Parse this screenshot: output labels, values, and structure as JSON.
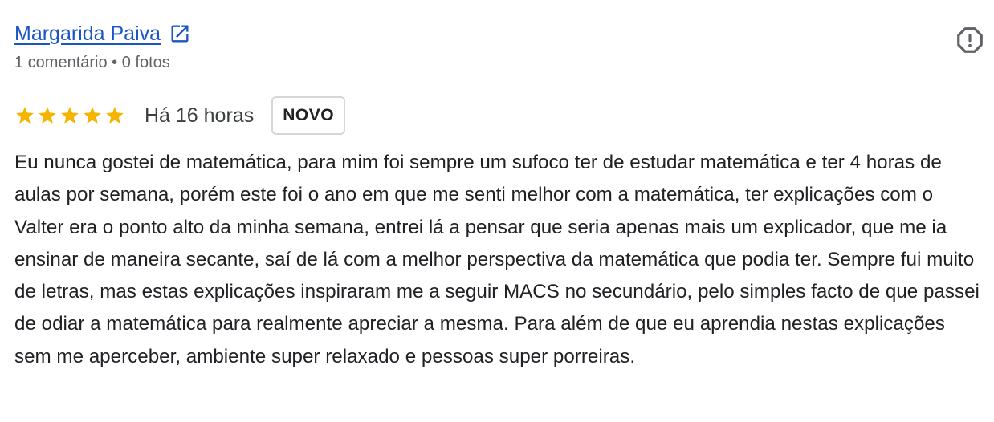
{
  "review": {
    "author_name": "Margarida Paiva",
    "author_meta": "1 comentário • 0 fotos",
    "rating": 5,
    "rating_max": 5,
    "time": "Há 16 horas",
    "badge": "NOVO",
    "text": "Eu nunca gostei de matemática, para mim foi sempre um sufoco ter de estudar matemática e ter 4 horas de aulas por semana, porém este foi o ano em que me senti melhor com a matemática, ter explicações com o Valter era o ponto alto da minha semana, entrei lá a pensar que seria apenas mais um explicador, que me ia ensinar de maneira secante, saí de lá com a melhor perspectiva da matemática que podia ter. Sempre fui muito de letras, mas estas explicações inspiraram me a seguir MACS no secundário, pelo simples facto de que passei de odiar a matemática para realmente apreciar a mesma. Para além de que eu aprendia nestas explicações sem me aperceber, ambiente super relaxado e pessoas super porreiras."
  },
  "icons": {
    "external_link": "open-in-new-icon",
    "report": "report-flag-icon",
    "star": "star-icon"
  },
  "colors": {
    "link": "#1a55c8",
    "star": "#f4b400",
    "meta": "#5f6368",
    "text": "#202124",
    "badge_border": "#d6d6d6"
  }
}
